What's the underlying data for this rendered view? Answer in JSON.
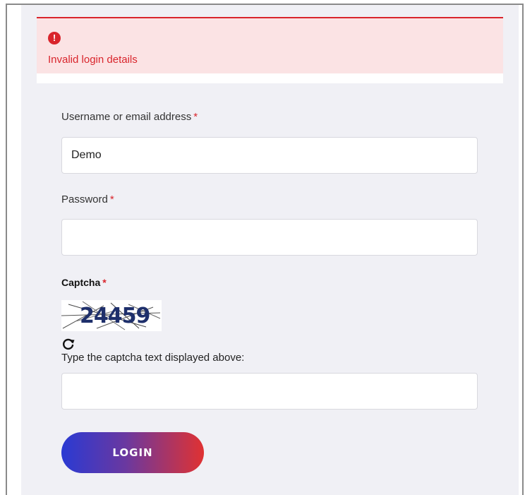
{
  "alert": {
    "icon": "exclamation-icon",
    "icon_glyph": "!",
    "message": "Invalid login details",
    "color": "#d9252c"
  },
  "form": {
    "username": {
      "label": "Username or email address",
      "required_mark": "*",
      "value": "Demo"
    },
    "password": {
      "label": "Password",
      "required_mark": "*",
      "value": ""
    },
    "captcha": {
      "label": "Captcha",
      "required_mark": "*",
      "image_text": "24459",
      "refresh_icon": "refresh-icon",
      "hint": "Type the captcha text displayed above:",
      "value": ""
    },
    "submit_label": "LOGIN"
  },
  "colors": {
    "panel_bg": "#f0f0f5",
    "error": "#d9252c",
    "button_gradient_start": "#2a3ad3",
    "button_gradient_end": "#e03232"
  }
}
